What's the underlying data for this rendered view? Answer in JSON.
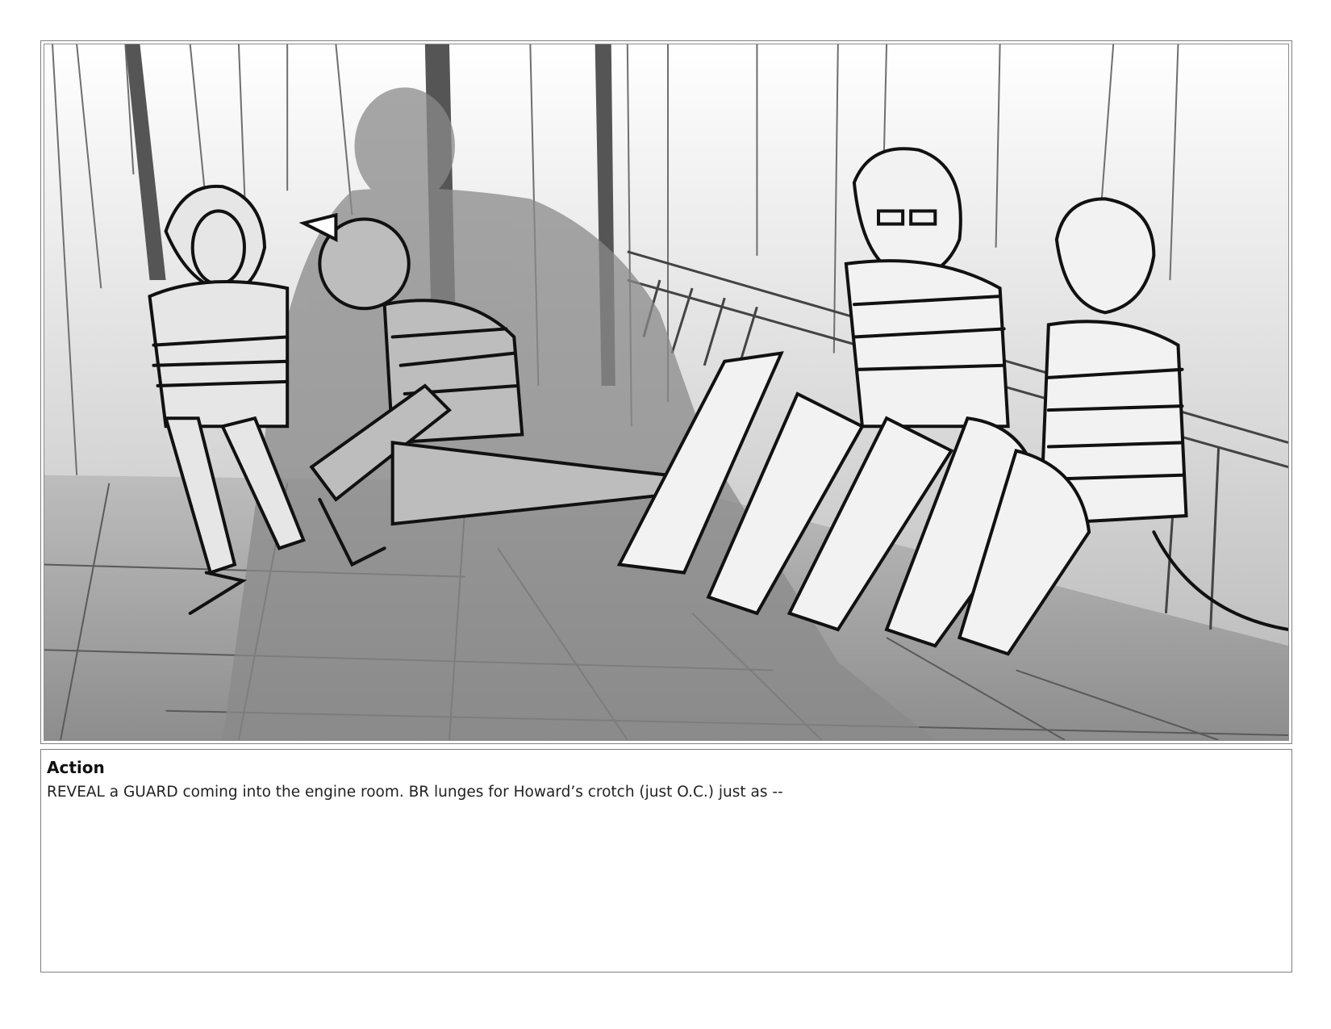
{
  "panel": {
    "image_description_name": "storyboard-sketch",
    "colors": {
      "border": "#7f7f7f",
      "ink": "#111111",
      "shadow": "#8a8a8a",
      "floor": "#a9a9a9",
      "wall": "#d8d8d8"
    }
  },
  "notes": {
    "label": "Action",
    "text": "REVEAL a GUARD coming into the engine room. BR lunges for Howard’s crotch (just O.C.) just as --"
  }
}
